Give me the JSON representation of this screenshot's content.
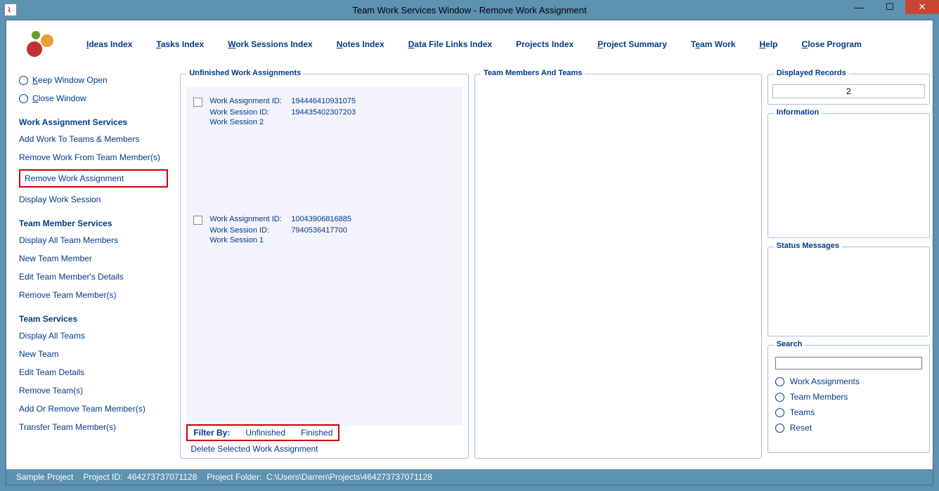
{
  "window": {
    "title": "Team Work Services Window - Remove Work Assignment"
  },
  "menu": {
    "ideas": "Ideas Index",
    "tasks": "Tasks Index",
    "work_sessions": "Work Sessions Index",
    "notes": "Notes Index",
    "datafile": "Data File Links Index",
    "projects": "Projects Index",
    "project_summary": "Project Summary",
    "team_work": "Team Work",
    "help": "Help",
    "close": "Close Program"
  },
  "sidebar": {
    "keep_open": "Keep Window Open",
    "close_window": "Close Window",
    "sec1_title": "Work Assignment Services",
    "sec1_items": [
      "Add Work To Teams & Members",
      "Remove Work From Team Member(s)",
      "Remove Work Assignment",
      "Display Work Session"
    ],
    "sec2_title": "Team Member Services",
    "sec2_items": [
      "Display All Team Members",
      "New Team Member",
      "Edit Team Member's Details",
      "Remove Team Member(s)"
    ],
    "sec3_title": "Team Services",
    "sec3_items": [
      "Display All Teams",
      "New Team",
      "Edit Team Details",
      "Remove Team(s)",
      "Add Or Remove Team Member(s)",
      "Transfer Team Member(s)"
    ]
  },
  "panels": {
    "unfinished": "Unfinished Work Assignments",
    "members": "Team Members And Teams",
    "displayed": "Displayed Records",
    "displayed_count": "2",
    "information": "Information",
    "status": "Status Messages",
    "search": "Search"
  },
  "assignments": [
    {
      "wa_label": "Work Assignment ID:",
      "wa_id": "194446410931075",
      "ws_label": "Work Session ID:",
      "ws_id": "194435402307203",
      "ws_name": "Work Session 2"
    },
    {
      "wa_label": "Work Assignment ID:",
      "wa_id": "10043906816885",
      "ws_label": "Work Session ID:",
      "ws_id": "7940536417700",
      "ws_name": "Work Session 1"
    }
  ],
  "filter": {
    "label": "Filter By:",
    "unfinished": "Unfinished",
    "finished": "Finished"
  },
  "delete_link": "Delete Selected Work Assignment",
  "search_options": {
    "wa": "Work Assignments",
    "tm": "Team Members",
    "teams": "Teams",
    "reset": "Reset"
  },
  "statusbar": {
    "project": "Sample Project",
    "project_id_label": "Project ID:",
    "project_id": "464273737071128",
    "folder_label": "Project Folder:",
    "folder": "C:\\Users\\Darren\\Projects\\464273737071128"
  }
}
